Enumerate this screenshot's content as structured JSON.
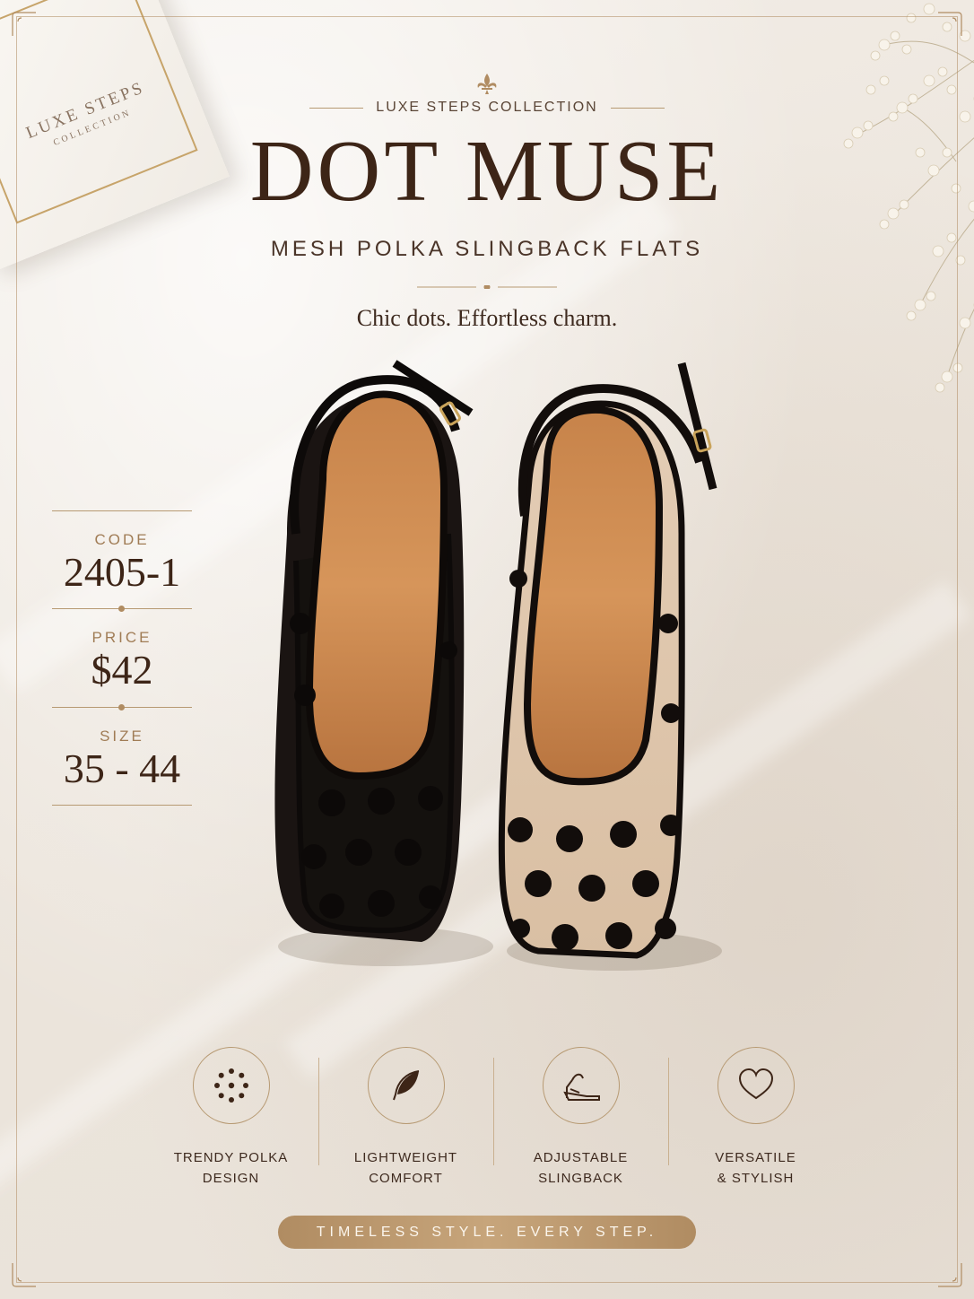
{
  "box": {
    "line1": "LUXE STEPS",
    "line2": "COLLECTION"
  },
  "header": {
    "collection": "LUXE STEPS COLLECTION",
    "title": "DOT MUSE",
    "subtitle": "MESH POLKA SLINGBACK FLATS",
    "tagline": "Chic dots. Effortless charm."
  },
  "specs": [
    {
      "label": "CODE",
      "value": "2405-1"
    },
    {
      "label": "PRICE",
      "value": "$42"
    },
    {
      "label": "SIZE",
      "value": "35 - 44"
    }
  ],
  "features": [
    {
      "icon": "polka-dots-icon",
      "label": "TRENDY POLKA\nDESIGN"
    },
    {
      "icon": "feather-icon",
      "label": "LIGHTWEIGHT\nCOMFORT"
    },
    {
      "icon": "slingback-shoe-icon",
      "label": "ADJUSTABLE\nSLINGBACK"
    },
    {
      "icon": "heart-icon",
      "label": "VERSATILE\n& STYLISH"
    }
  ],
  "footer": {
    "slogan": "TIMELESS STYLE. EVERY STEP."
  },
  "colors": {
    "accent": "#b08c62",
    "text_dark": "#3d2517",
    "background": "#efe9e2"
  }
}
